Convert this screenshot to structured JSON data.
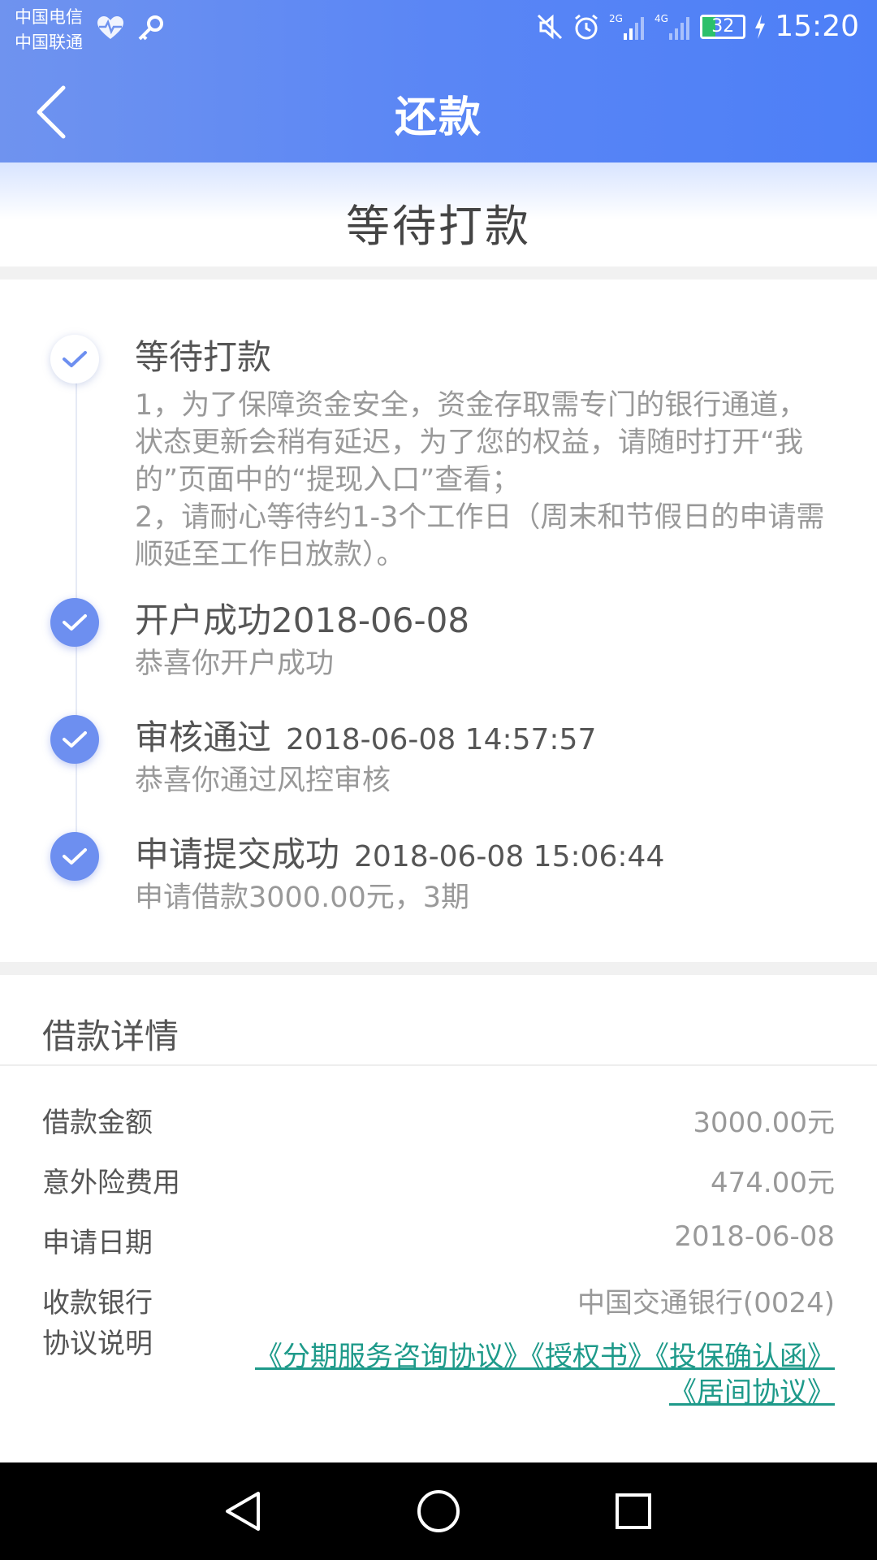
{
  "status_bar": {
    "carrier_1": "中国电信",
    "carrier_2": "中国联通",
    "network_1": "2G",
    "network_2": "4G",
    "battery": "32",
    "time": "15:20"
  },
  "nav": {
    "title": "还款",
    "back_icon": "chevron-left-icon"
  },
  "banner": {
    "status": "等待打款"
  },
  "timeline": {
    "steps": [
      {
        "title": "等待打款",
        "time": "",
        "desc_1": "1，为了保障资金安全，资金存取需专门的银行通道，状态更新会稍有延迟，为了您的权益，请随时打开“我的”页面中的“提现入口”查看；",
        "desc_2": "2，请耐心等待约1-3个工作日（周末和节假日的申请需顺延至工作日放款）。",
        "state": "current"
      },
      {
        "title": "开户成功2018-06-08",
        "time": "",
        "desc": "恭喜你开户成功",
        "state": "done"
      },
      {
        "title": "审核通过",
        "time": "2018-06-08 14:57:57",
        "desc": "恭喜你通过风控审核",
        "state": "done"
      },
      {
        "title": "申请提交成功",
        "time": "2018-06-08 15:06:44",
        "desc": "申请借款3000.00元，3期",
        "state": "done"
      }
    ]
  },
  "details": {
    "title": "借款详情",
    "rows": [
      {
        "label": "借款金额",
        "value": "3000.00元"
      },
      {
        "label": "意外险费用",
        "value": "474.00元"
      },
      {
        "label": "申请日期",
        "value": "2018-06-08"
      },
      {
        "label": "收款银行",
        "value": "中国交通银行(0024)"
      }
    ],
    "agreement_label": "协议说明",
    "agreements": [
      "《分期服务咨询协议》",
      "《授权书》",
      "《投保确认函》",
      "《居间协议》"
    ]
  },
  "colors": {
    "header_blue": "#5a86f5",
    "check_blue": "#6d8ff0",
    "link_teal": "#1e9a8a"
  }
}
